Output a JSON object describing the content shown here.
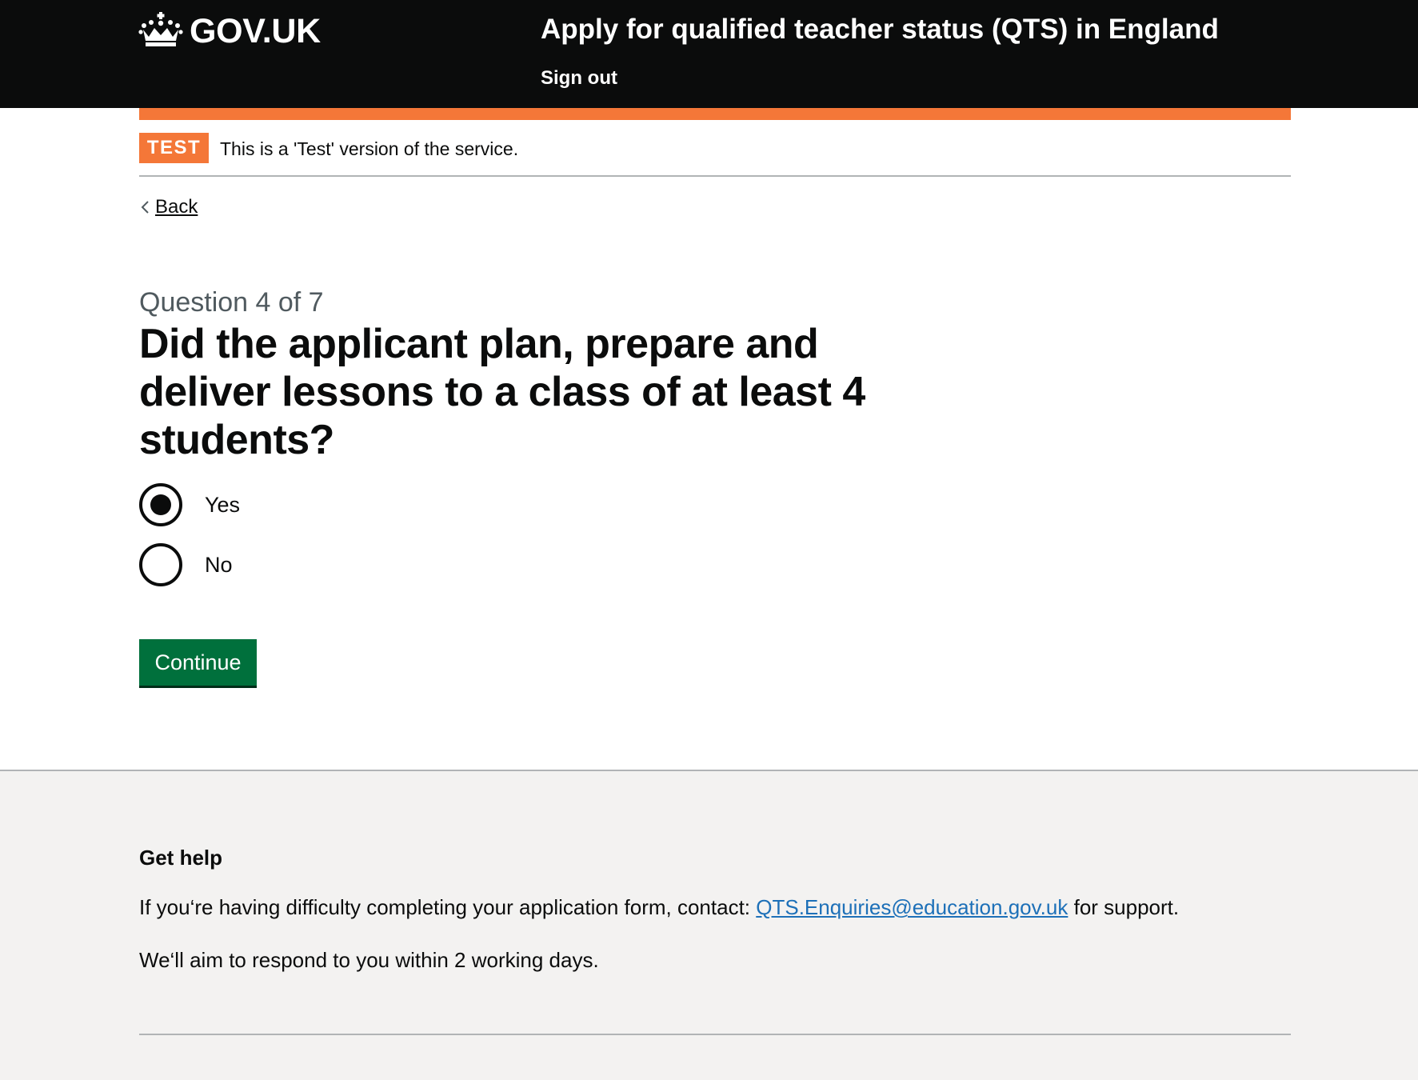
{
  "header": {
    "logo_text": "GOV.UK",
    "service_name": "Apply for qualified teacher status (QTS) in England",
    "sign_out": "Sign out"
  },
  "phase_banner": {
    "tag": "TEST",
    "text": "This is a 'Test' version of the service."
  },
  "back_link": "Back",
  "question": {
    "caption": "Question 4 of 7",
    "title": "Did the applicant plan, prepare and deliver lessons to a class of at least 4 students?",
    "options": [
      {
        "label": "Yes",
        "checked": true
      },
      {
        "label": "No",
        "checked": false
      }
    ],
    "submit_label": "Continue"
  },
  "footer": {
    "heading": "Get help",
    "p1_before": "If you‘re having difficulty completing your application form, contact: ",
    "p1_link": "QTS.Enquiries@education.gov.uk",
    "p1_after": " for support.",
    "p2": "We‘ll aim to respond to you within 2 working days."
  },
  "colors": {
    "header_bg": "#0b0c0c",
    "phase_orange": "#f47738",
    "button_green": "#00703c",
    "link_blue": "#1d70b8",
    "footer_bg": "#f3f2f1"
  }
}
